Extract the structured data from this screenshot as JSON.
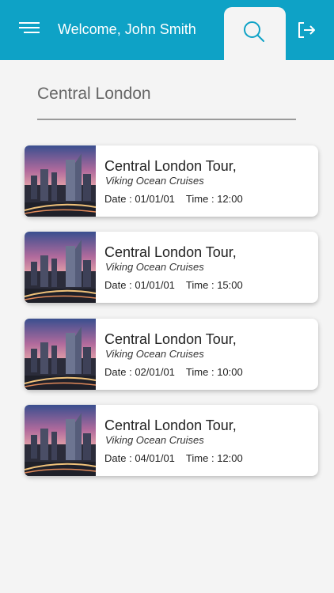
{
  "header": {
    "welcome_text": "Welcome, John Smith",
    "icons": {
      "menu": "hamburger-menu-icon",
      "search": "search-icon",
      "logout": "logout-icon"
    },
    "colors": {
      "header_bg": "#0ea2c6",
      "active_tab_bg": "#f4f4f4",
      "search_icon": "#0ea2c6"
    }
  },
  "location": {
    "value": "Central London"
  },
  "tours": [
    {
      "title": "Central London Tour,",
      "operator": "Viking Ocean Cruises",
      "date_label": "Date :",
      "date": "01/01/01",
      "time_label": "Time :",
      "time": "12:00"
    },
    {
      "title": "Central London Tour,",
      "operator": "Viking Ocean Cruises",
      "date_label": "Date :",
      "date": "01/01/01",
      "time_label": "Time :",
      "time": "15:00"
    },
    {
      "title": "Central London Tour,",
      "operator": "Viking Ocean Cruises",
      "date_label": "Date :",
      "date": "02/01/01",
      "time_label": "Time :",
      "time": "10:00"
    },
    {
      "title": "Central London Tour,",
      "operator": "Viking Ocean Cruises",
      "date_label": "Date :",
      "date": "04/01/01",
      "time_label": "Time :",
      "time": "12:00"
    }
  ]
}
